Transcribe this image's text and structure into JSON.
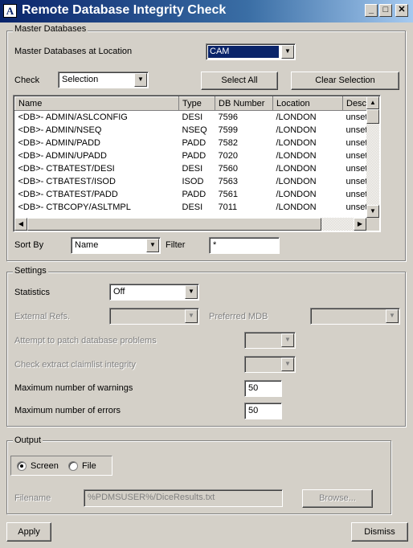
{
  "window": {
    "title": "Remote Database Integrity Check"
  },
  "master": {
    "group_title": "Master Databases",
    "location_label": "Master Databases at Location",
    "location_value": "CAM",
    "check_label": "Check",
    "check_value": "Selection",
    "select_all": "Select All",
    "clear_selection": "Clear Selection",
    "columns": [
      "Name",
      "Type",
      "DB Number",
      "Location",
      "Desc"
    ],
    "rows": [
      [
        "<DB>-    ADMIN/ASLCONFIG",
        "DESI",
        "7596",
        "/LONDON",
        "unset"
      ],
      [
        "<DB>-    ADMIN/NSEQ",
        "NSEQ",
        "7599",
        "/LONDON",
        "unset"
      ],
      [
        "<DB>-    ADMIN/PADD",
        "PADD",
        "7582",
        "/LONDON",
        "unset"
      ],
      [
        "<DB>-    ADMIN/UPADD",
        "PADD",
        "7020",
        "/LONDON",
        "unset"
      ],
      [
        "<DB>-    CTBATEST/DESI",
        "DESI",
        "7560",
        "/LONDON",
        "unset"
      ],
      [
        "<DB>-    CTBATEST/ISOD",
        "ISOD",
        "7563",
        "/LONDON",
        "unset"
      ],
      [
        "<DB>-    CTBATEST/PADD",
        "PADD",
        "7561",
        "/LONDON",
        "unset"
      ],
      [
        "<DB>-    CTBCOPY/ASLTMPL",
        "DESI",
        "7011",
        "/LONDON",
        "unset"
      ]
    ],
    "sort_by_label": "Sort By",
    "sort_by_value": "Name",
    "filter_label": "Filter",
    "filter_value": "*"
  },
  "settings": {
    "group_title": "Settings",
    "statistics_label": "Statistics",
    "statistics_value": "Off",
    "external_refs_label": "External Refs.",
    "preferred_mdb_label": "Preferred MDB",
    "patch_label": "Attempt to patch database problems",
    "claimlist_label": "Check extract claimlist integrity",
    "max_warnings_label": "Maximum number of warnings",
    "max_warnings_value": "50",
    "max_errors_label": "Maximum number of errors",
    "max_errors_value": "50"
  },
  "output": {
    "group_title": "Output",
    "screen_label": "Screen",
    "file_label": "File",
    "filename_label": "Filename",
    "filename_value": "%PDMSUSER%/DiceResults.txt",
    "browse": "Browse..."
  },
  "footer": {
    "apply": "Apply",
    "dismiss": "Dismiss"
  }
}
